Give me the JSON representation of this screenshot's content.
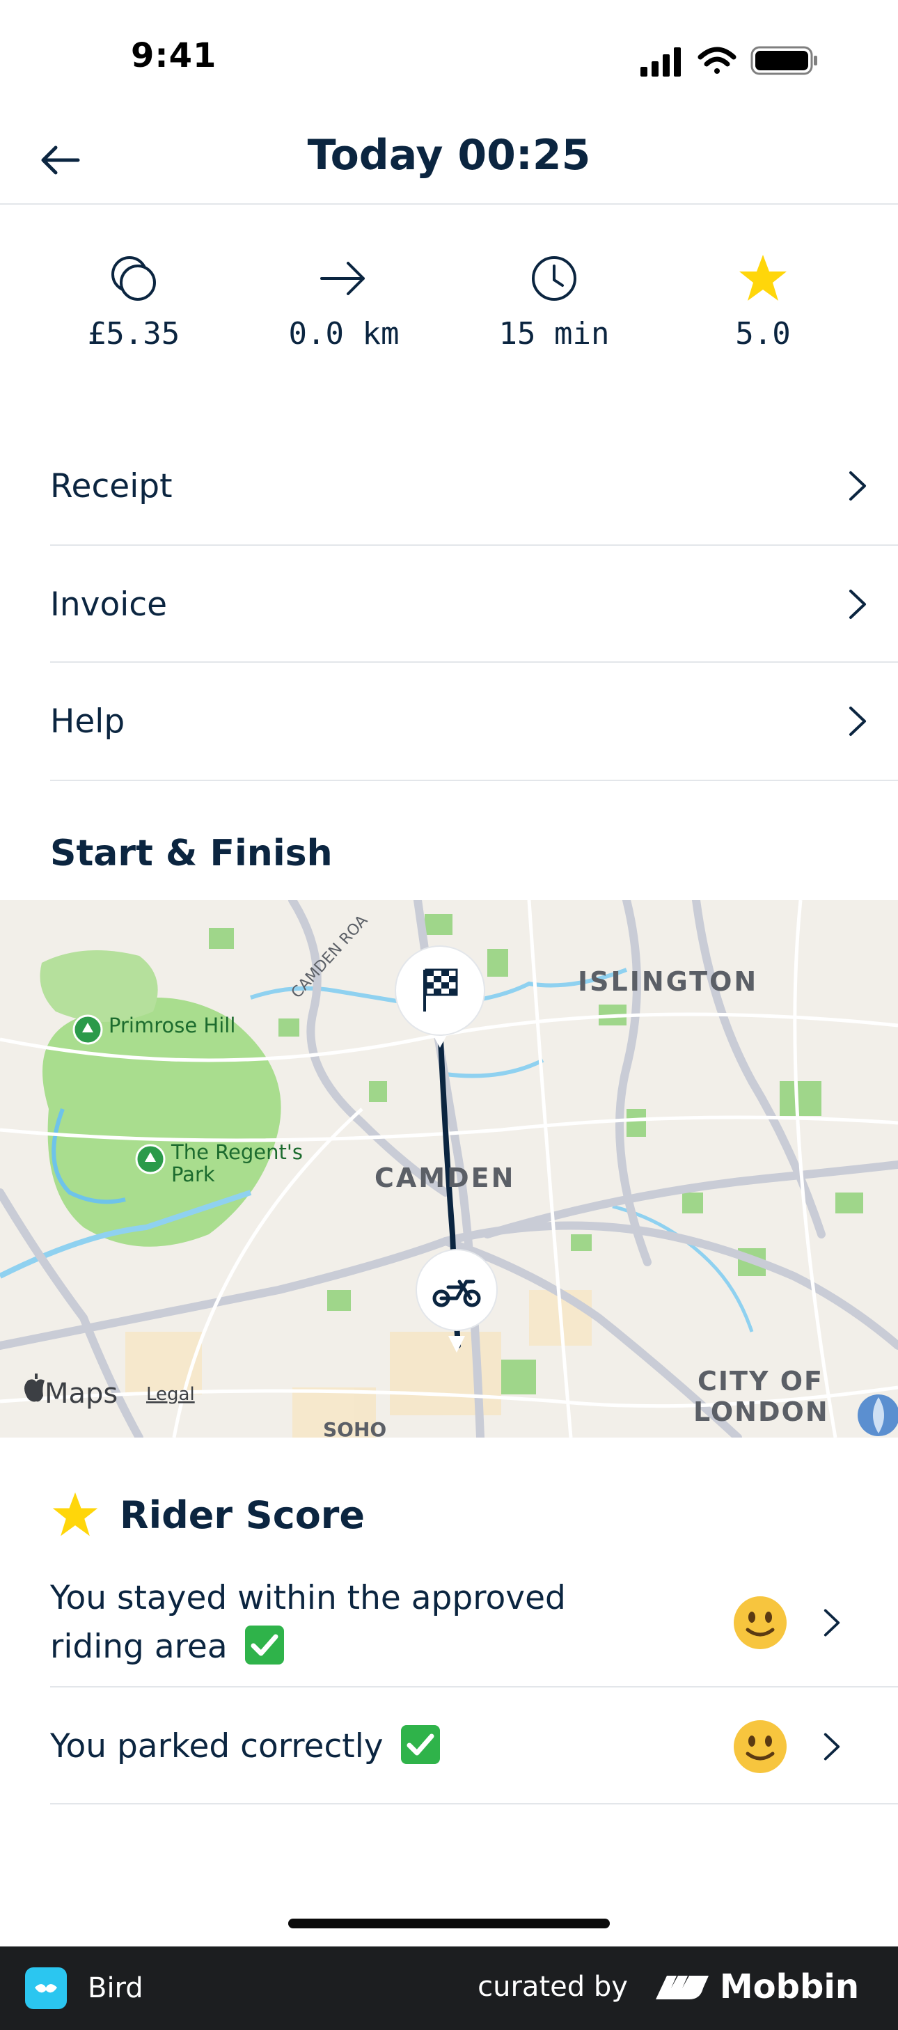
{
  "status_bar": {
    "time": "9:41"
  },
  "header": {
    "title": "Today 00:25"
  },
  "stats": [
    {
      "icon": "coins-icon",
      "value": "£5.35"
    },
    {
      "icon": "arrow-right-icon",
      "value": "0.0 km"
    },
    {
      "icon": "clock-icon",
      "value": "15 min"
    },
    {
      "icon": "star-icon",
      "value": "5.0"
    }
  ],
  "menu": [
    {
      "label": "Receipt"
    },
    {
      "label": "Invoice"
    },
    {
      "label": "Help"
    }
  ],
  "map_section": {
    "title": "Start & Finish",
    "labels": {
      "islington": "ISLINGTON",
      "camden": "CAMDEN",
      "primrose": "Primrose Hill",
      "regents_1": "The Regent's",
      "regents_2": "Park",
      "camden_road": "CAMDEN ROA",
      "city_1": "CITY OF",
      "city_2": "LONDON",
      "soho": "SOHO",
      "maps": "Maps",
      "legal": "Legal"
    }
  },
  "rider_score": {
    "title": "Rider Score",
    "items": [
      {
        "line1": "You stayed within the approved",
        "line2": "riding area"
      },
      {
        "line1": "You parked correctly"
      }
    ]
  },
  "footer": {
    "app_name": "Bird",
    "curated_label": "curated by",
    "brand": "Mobbin"
  },
  "colors": {
    "accent_star": "#ffd60a",
    "route": "#0b2540",
    "text": "#0b2540",
    "check": "#2fb34a"
  }
}
